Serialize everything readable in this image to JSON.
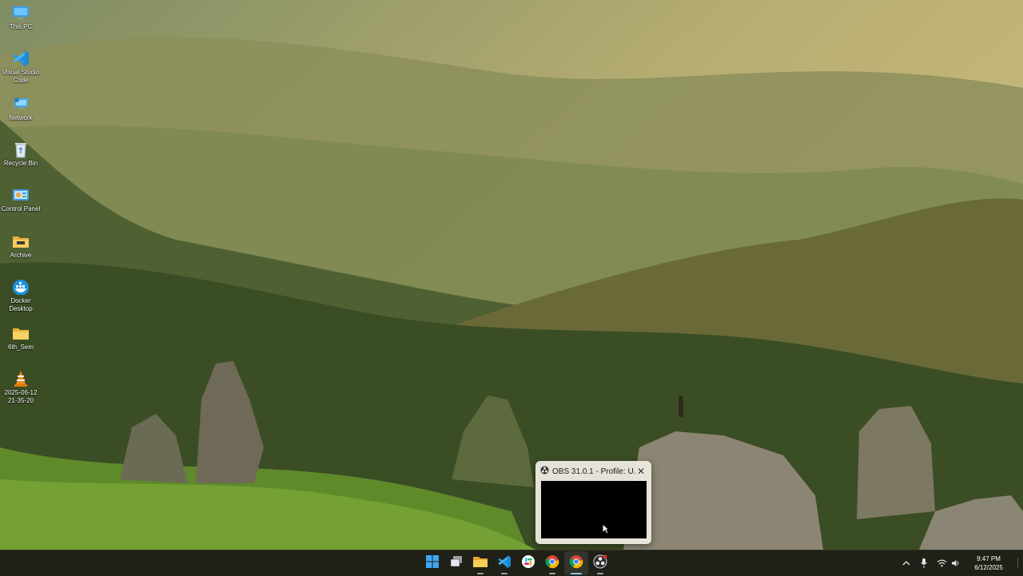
{
  "desktop": {
    "icons": [
      {
        "label": "This PC",
        "icon": "monitor-icon"
      },
      {
        "label": "Visual Studio\nCode",
        "icon": "vscode-icon"
      },
      {
        "label": "Network",
        "icon": "network-icon"
      },
      {
        "label": "Recycle Bin",
        "icon": "recycle-bin-icon"
      },
      {
        "label": "Control Panel",
        "icon": "control-panel-icon"
      },
      {
        "label": "Archive",
        "icon": "folder-icon"
      },
      {
        "label": "Docker\nDesktop",
        "icon": "docker-icon"
      },
      {
        "label": "6th_Sem",
        "icon": "folder-icon"
      },
      {
        "label": "2025-06-12\n21-35-20",
        "icon": "vlc-icon"
      }
    ]
  },
  "obs_preview": {
    "title": "OBS 31.0.1 - Profile: U...",
    "close_icon": "close-icon"
  },
  "taskbar": {
    "apps": [
      {
        "name": "Start",
        "icon": "windows-start-icon"
      },
      {
        "name": "Task View",
        "icon": "task-view-icon"
      },
      {
        "name": "File Explorer",
        "icon": "file-explorer-icon"
      },
      {
        "name": "Visual Studio Code",
        "icon": "vscode-icon"
      },
      {
        "name": "Slack",
        "icon": "slack-icon"
      },
      {
        "name": "Chrome",
        "icon": "chrome-icon"
      },
      {
        "name": "Chrome",
        "icon": "chrome-icon"
      },
      {
        "name": "OBS Studio",
        "icon": "obs-icon"
      }
    ],
    "tray": {
      "time": "9:47 PM",
      "date": "6/12/2025"
    }
  },
  "colors": {
    "taskbar_bg": "#1f2017",
    "accent": "#7cc7ff"
  }
}
